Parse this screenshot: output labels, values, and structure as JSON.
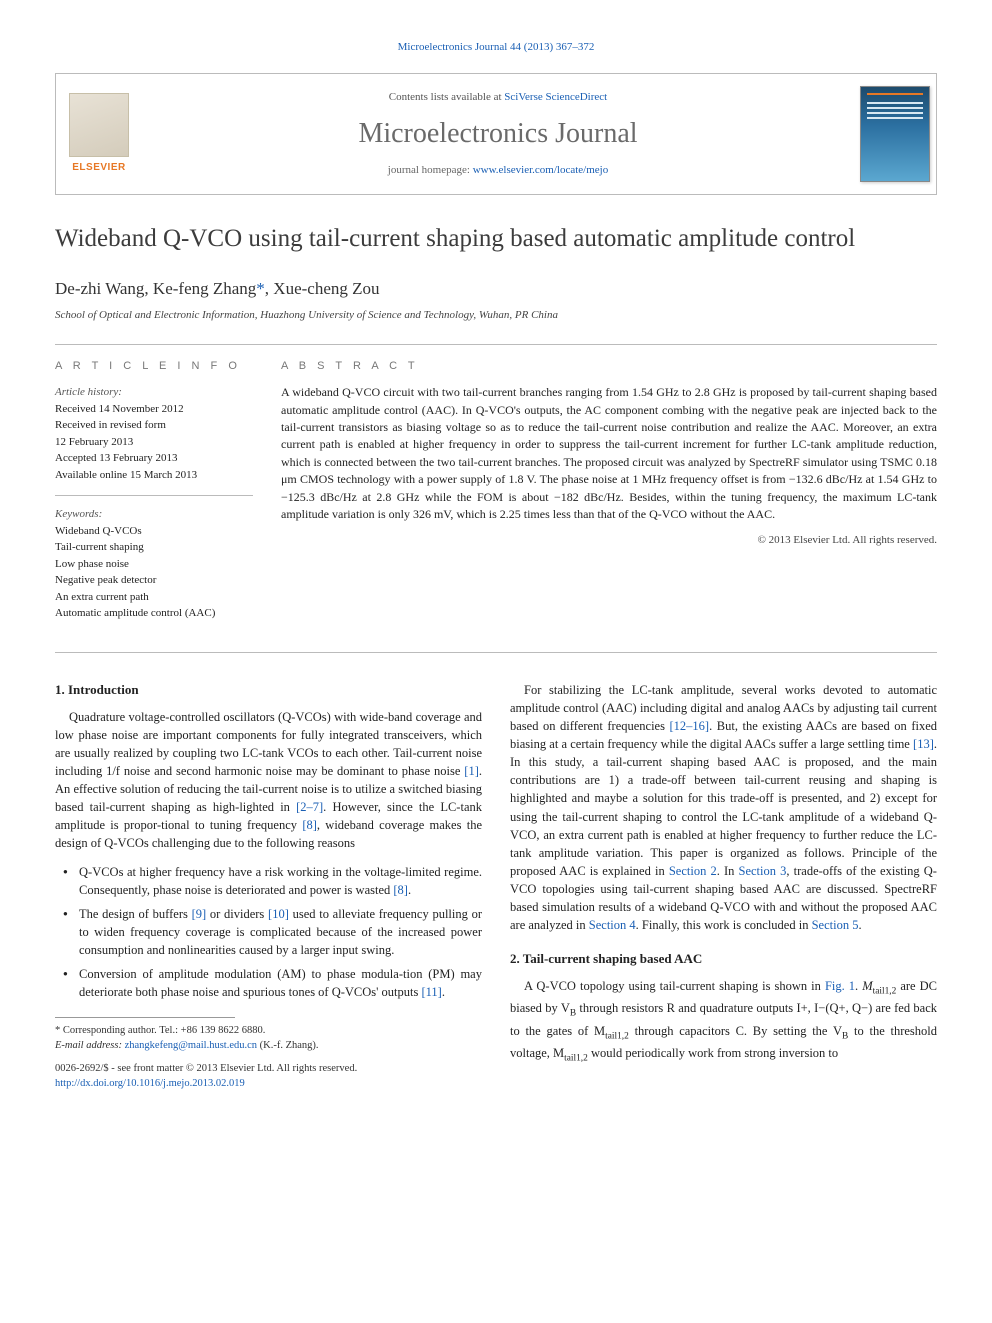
{
  "top_citation": {
    "prefix": "",
    "link_text": "Microelectronics Journal 44 (2013) 367–372",
    "suffix": ""
  },
  "header": {
    "publisher": "ELSEVIER",
    "contents_prefix": "Contents lists available at ",
    "contents_link": "SciVerse ScienceDirect",
    "journal_name": "Microelectronics Journal",
    "homepage_prefix": "journal homepage: ",
    "homepage_link": "www.elsevier.com/locate/mejo"
  },
  "article": {
    "title": "Wideband Q-VCO using tail-current shaping based automatic amplitude control",
    "authors_html": "De-zhi Wang, Ke-feng Zhang",
    "author_corr_marker": "*",
    "author_last": ", Xue-cheng Zou",
    "affiliation": "School of Optical and Electronic Information, Huazhong University of Science and Technology, Wuhan, PR China"
  },
  "info": {
    "label": "A R T I C L E  I N F O",
    "history_label": "Article history:",
    "history_lines": [
      "Received 14 November 2012",
      "Received in revised form",
      "12 February 2013",
      "Accepted 13 February 2013",
      "Available online 15 March 2013"
    ],
    "keywords_label": "Keywords:",
    "keywords": [
      "Wideband Q-VCOs",
      "Tail-current shaping",
      "Low phase noise",
      "Negative peak detector",
      "An extra current path",
      "Automatic amplitude control (AAC)"
    ]
  },
  "abstract": {
    "label": "A B S T R A C T",
    "text": "A wideband Q-VCO circuit with two tail-current branches ranging from 1.54 GHz to 2.8 GHz is proposed by tail-current shaping based automatic amplitude control (AAC). In Q-VCO's outputs, the AC component combing with the negative peak are injected back to the tail-current transistors as biasing voltage so as to reduce the tail-current noise contribution and realize the AAC. Moreover, an extra current path is enabled at higher frequency in order to suppress the tail-current increment for further LC-tank amplitude reduction, which is connected between the two tail-current branches. The proposed circuit was analyzed by SpectreRF simulator using TSMC 0.18 μm CMOS technology with a power supply of 1.8 V. The phase noise at 1 MHz frequency offset is from −132.6 dBc/Hz at 1.54 GHz to −125.3 dBc/Hz at 2.8 GHz while the FOM is about −182 dBc/Hz. Besides, within the tuning frequency, the maximum LC-tank amplitude variation is only 326 mV, which is 2.25 times less than that of the Q-VCO without the AAC.",
    "copyright": "© 2013 Elsevier Ltd. All rights reserved."
  },
  "sections": {
    "s1_title": "1.  Introduction",
    "s1_p1": "Quadrature voltage-controlled oscillators (Q-VCOs) with wide-band coverage and low phase noise are important components for fully integrated transceivers, which are usually realized by coupling two LC-tank VCOs to each other. Tail-current noise including 1/f noise and second harmonic noise may be dominant to phase noise ",
    "s1_p1_ref": "[1]",
    "s1_p1b": ". An effective solution of reducing the tail-current noise is to utilize a switched biasing based tail-current shaping as high-lighted in ",
    "s1_p1_ref2": "[2–7]",
    "s1_p1c": ". However, since the LC-tank amplitude is propor-tional to tuning frequency ",
    "s1_p1_ref3": "[8]",
    "s1_p1d": ", wideband coverage makes the design of Q-VCOs challenging due to the following reasons",
    "bullet1a": "Q-VCOs at higher frequency have a risk working in the voltage-limited regime. Consequently, phase noise is deteriorated and power is wasted ",
    "bullet1a_ref": "[8]",
    "bullet1a_end": ".",
    "bullet1b_a": "The design of buffers ",
    "bullet1b_ref1": "[9]",
    "bullet1b_b": " or dividers ",
    "bullet1b_ref2": "[10]",
    "bullet1b_c": " used to alleviate frequency pulling or to widen frequency coverage is complicated because of the increased power consumption and nonlinearities caused by a larger input swing.",
    "bullet1c_a": "Conversion of amplitude modulation (AM) to phase modula-tion (PM) may deteriorate both phase noise and spurious tones of Q-VCOs' outputs ",
    "bullet1c_ref": "[11]",
    "bullet1c_b": ".",
    "s1_p2a": "For stabilizing the LC-tank amplitude, several works devoted to automatic amplitude control (AAC) including digital and analog AACs by adjusting tail current based on different frequencies ",
    "s1_p2_ref1": "[12–16]",
    "s1_p2b": ". But, the existing AACs are based on fixed biasing at a certain frequency while the digital AACs suffer a large settling time ",
    "s1_p2_ref2": "[13]",
    "s1_p2c": ". In this study, a tail-current shaping based AAC is proposed, and the main contributions are 1) a trade-off between tail-current reusing and shaping is highlighted and maybe a solution for this trade-off is presented, and 2) except for using the tail-current shaping to control the LC-tank amplitude of a wideband Q-VCO, an extra current path is enabled at higher frequency to further reduce the LC-tank amplitude variation. This paper is organized as follows. Principle of the proposed AAC is explained in ",
    "s1_p2_link1": "Section 2",
    "s1_p2d": ". In ",
    "s1_p2_link2": "Section 3",
    "s1_p2e": ", trade-offs of the existing Q-VCO topologies using tail-current shaping based AAC are discussed. SpectreRF based simulation results of a wideband Q-VCO with and without the proposed AAC are analyzed in ",
    "s1_p2_link3": "Section 4",
    "s1_p2f": ". Finally, this work is concluded in ",
    "s1_p2_link4": "Section 5",
    "s1_p2g": ".",
    "s2_title": "2.  Tail-current shaping based AAC",
    "s2_p1a": "A Q-VCO topology using tail-current shaping is shown in ",
    "s2_p1_ref": "Fig. 1",
    "s2_p1b": ". ",
    "s2_m1": "M",
    "s2_m1s": "tail1,2",
    "s2_p1c": " are DC biased by V",
    "s2_vb": "B",
    "s2_p1d": " through resistors R and quadrature outputs I+, I−(Q+, Q−) are fed back to the gates of M",
    "s2_m1s2": "tail1,2",
    "s2_p1e": " through capacitors C. By setting the V",
    "s2_vb2": "B",
    "s2_p1f": " to the threshold voltage, M",
    "s2_m1s3": "tail1,2",
    "s2_p1g": " would periodically work from strong inversion to"
  },
  "footnotes": {
    "corr": "* Corresponding author. Tel.: +86 139 8622 6880.",
    "email_label": "E-mail address: ",
    "email": "zhangkefeng@mail.hust.edu.cn",
    "email_who": " (K.-f. Zhang).",
    "issn_line": "0026-2692/$ - see front matter © 2013 Elsevier Ltd. All rights reserved.",
    "doi_label": "http://dx.doi.org/",
    "doi": "10.1016/j.mejo.2013.02.019"
  }
}
